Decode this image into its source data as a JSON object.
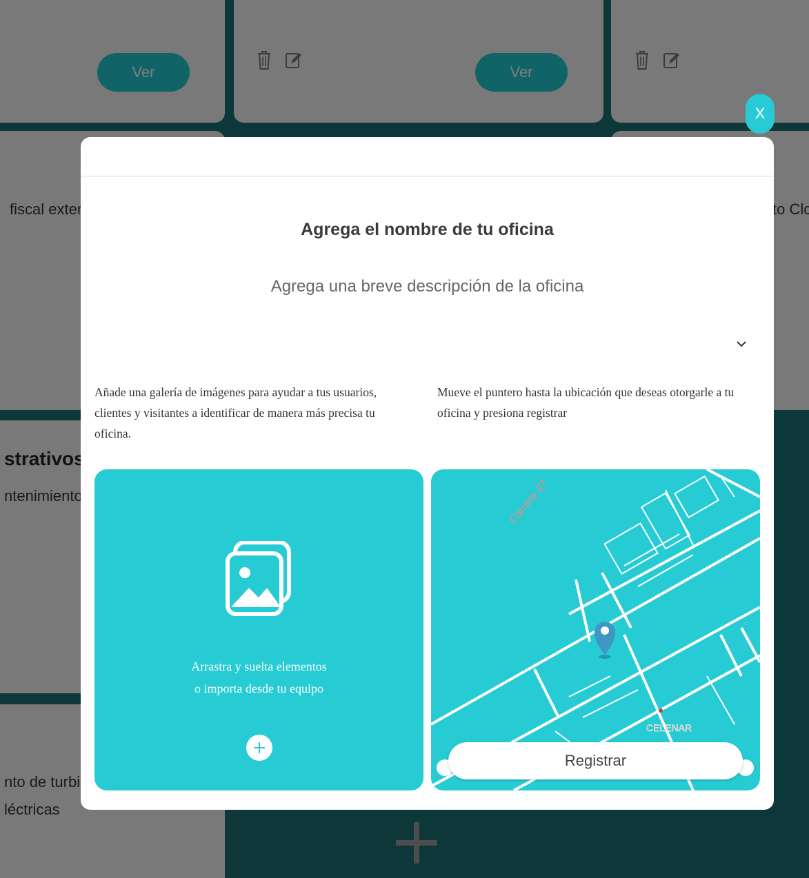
{
  "background": {
    "cards": [
      {
        "view_label": "Ver"
      },
      {
        "view_label": "Ver"
      }
    ],
    "fragments": {
      "fiscal": "fiscal externa",
      "clc": "to Clc",
      "section_heading": "strativos",
      "mantenimiento": "ntenimiento i",
      "turbina_1": "nto de turbina",
      "turbina_2": "léctricas"
    },
    "icons": [
      "trash-icon",
      "edit-icon",
      "plus-icon"
    ]
  },
  "close_button": {
    "label": "X"
  },
  "modal": {
    "title": "Agrega el nombre de tu oficina",
    "subtitle": "Agrega una breve descripción de la oficina",
    "gallery_description": "Añade una galería de imágenes para ayudar a tus usuarios, clientes y visitantes a identificar de manera más precisa tu oficina.",
    "map_description": "Mueve el puntero hasta la ubicación que deseas otorgarle a tu oficina y presiona registrar",
    "upload": {
      "line1": "Arrastra y suelta elementos",
      "line2": "o importa desde tu equipo"
    },
    "map": {
      "street_label": "Carrera 37",
      "place_label": "CELENAR",
      "register_label": "Registrar"
    }
  },
  "colors": {
    "accent": "#27cbd4",
    "background_teal": "#1b6f72",
    "pin": "#3f97c4"
  }
}
